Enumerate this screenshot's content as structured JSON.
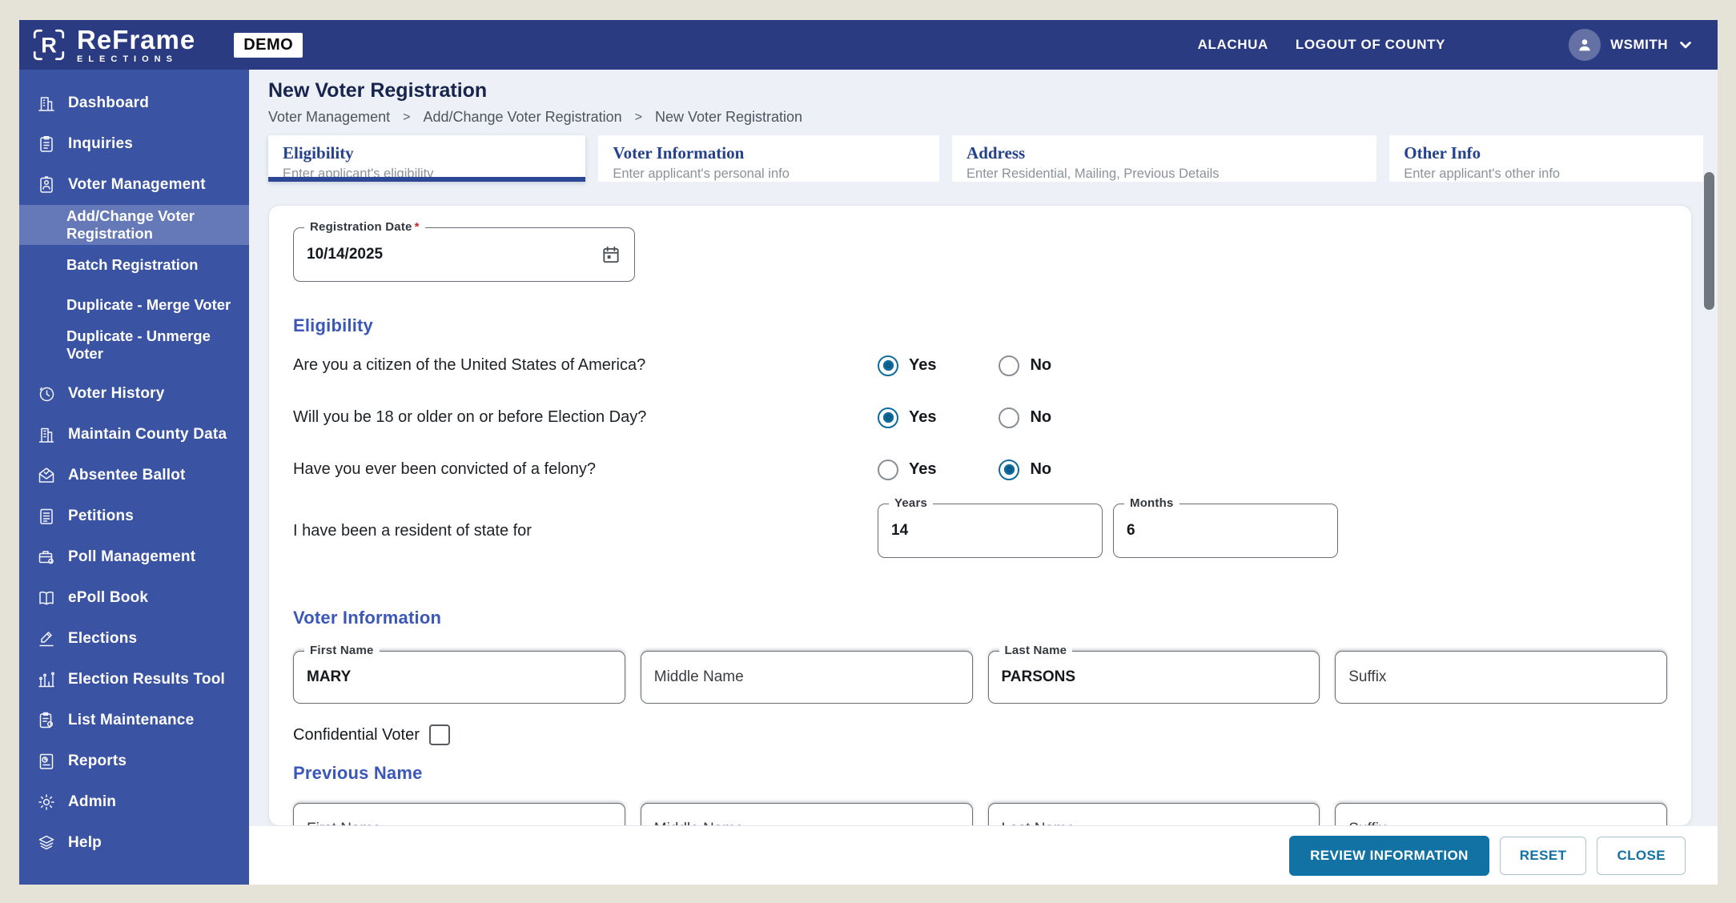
{
  "header": {
    "brand": {
      "logo_letter": "R",
      "logo_icon": "reframe-logo-icon",
      "name": "ReFrame",
      "tagline": "ELECTIONS"
    },
    "demo_badge": "DEMO",
    "county_label": "ALACHUA",
    "logout_label": "LOGOUT OF COUNTY",
    "user": {
      "name": "WSMITH",
      "avatar_icon": "user-avatar-icon",
      "chevron_icon": "chevron-down-icon"
    }
  },
  "sidebar": {
    "items": [
      {
        "label": "Dashboard",
        "icon": "dashboard-icon"
      },
      {
        "label": "Inquiries",
        "icon": "inquiries-icon"
      },
      {
        "label": "Voter Management",
        "icon": "voter-management-icon",
        "expanded": true,
        "children": [
          {
            "label": "Add/Change Voter Registration",
            "active": true
          },
          {
            "label": "Batch Registration",
            "active": false
          },
          {
            "label": "Duplicate - Merge Voter",
            "active": false
          },
          {
            "label": "Duplicate - Unmerge Voter",
            "active": false
          }
        ]
      },
      {
        "label": "Voter History",
        "icon": "voter-history-icon"
      },
      {
        "label": "Maintain County Data",
        "icon": "maintain-county-data-icon"
      },
      {
        "label": "Absentee Ballot",
        "icon": "absentee-ballot-icon"
      },
      {
        "label": "Petitions",
        "icon": "petitions-icon"
      },
      {
        "label": "Poll Management",
        "icon": "poll-management-icon"
      },
      {
        "label": "ePoll Book",
        "icon": "epoll-book-icon"
      },
      {
        "label": "Elections",
        "icon": "elections-icon"
      },
      {
        "label": "Election Results Tool",
        "icon": "election-results-tool-icon"
      },
      {
        "label": "List Maintenance",
        "icon": "list-maintenance-icon"
      },
      {
        "label": "Reports",
        "icon": "reports-icon"
      },
      {
        "label": "Admin",
        "icon": "admin-icon"
      },
      {
        "label": "Help",
        "icon": "help-icon"
      }
    ]
  },
  "page": {
    "title": "New Voter Registration",
    "breadcrumb": [
      "Voter Management",
      "Add/Change Voter Registration",
      "New Voter Registration"
    ],
    "breadcrumb_separator": ">"
  },
  "tabs": [
    {
      "title": "Eligibility",
      "subtitle": "Enter applicant's eligibility",
      "active": true
    },
    {
      "title": "Voter Information",
      "subtitle": "Enter applicant's personal info",
      "active": false
    },
    {
      "title": "Address",
      "subtitle": "Enter Residential, Mailing, Previous Details",
      "active": false
    },
    {
      "title": "Other Info",
      "subtitle": "Enter applicant's other info",
      "active": false
    }
  ],
  "form": {
    "registration_date": {
      "label": "Registration Date",
      "required_marker": "*",
      "value": "10/14/2025",
      "icon": "calendar-icon"
    },
    "eligibility": {
      "heading": "Eligibility",
      "option_labels": {
        "yes": "Yes",
        "no": "No"
      },
      "questions": [
        {
          "text": "Are you a citizen of the United States of America?",
          "answer": "Yes"
        },
        {
          "text": "Will you be 18 or older on or before Election Day?",
          "answer": "Yes"
        },
        {
          "text": "Have you ever been convicted of a felony?",
          "answer": "No"
        }
      ],
      "residency": {
        "text": "I have been a resident of state for",
        "years": {
          "label": "Years",
          "value": "14"
        },
        "months": {
          "label": "Months",
          "value": "6"
        }
      }
    },
    "voter_information": {
      "heading": "Voter Information",
      "first_name": {
        "label": "First Name",
        "value": "MARY"
      },
      "middle_name": {
        "placeholder": "Middle Name",
        "value": ""
      },
      "last_name": {
        "label": "Last Name",
        "value": "PARSONS"
      },
      "suffix": {
        "placeholder": "Suffix",
        "value": ""
      },
      "confidential_label": "Confidential Voter",
      "confidential_checked": false
    },
    "previous_name": {
      "heading": "Previous Name",
      "first_name": {
        "placeholder": "First Name"
      },
      "middle_name": {
        "placeholder": "Middle Name"
      },
      "last_name": {
        "placeholder": "Last Name"
      },
      "suffix": {
        "placeholder": "Suffix"
      }
    }
  },
  "footer": {
    "buttons": [
      {
        "label": "REVIEW INFORMATION",
        "style": "primary"
      },
      {
        "label": "RESET",
        "style": "outline"
      },
      {
        "label": "CLOSE",
        "style": "outline"
      }
    ]
  },
  "colors": {
    "header_bg": "#2a3b82",
    "sidebar_bg": "#3a53a3",
    "active_tab_underline": "#2b4795",
    "section_heading": "#3b57b8",
    "radio_selected": "#0e6d9e",
    "primary_button": "#1272a3",
    "required_asterisk": "#c62828",
    "frame_background": "#e5e3d7"
  }
}
